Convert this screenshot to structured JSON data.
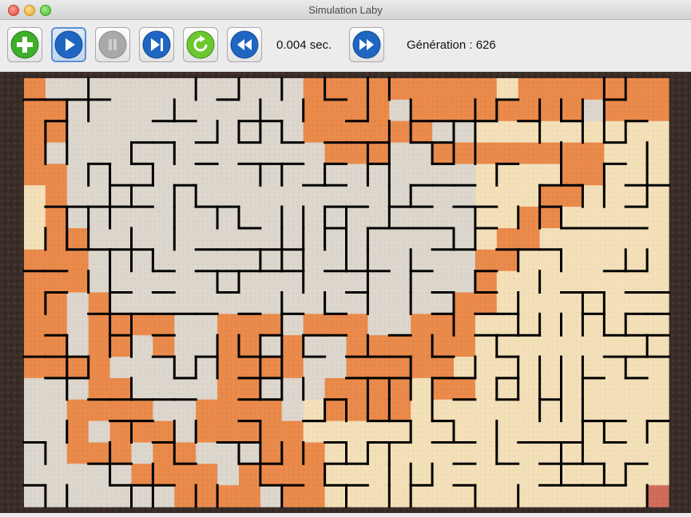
{
  "window": {
    "title": "Simulation Laby"
  },
  "toolbar": {
    "buttons": [
      {
        "name": "add-button",
        "icon": "plus-icon",
        "color": "#3fae2a"
      },
      {
        "name": "play-button",
        "icon": "play-icon",
        "color": "#1f66c2",
        "active": true
      },
      {
        "name": "pause-button",
        "icon": "pause-icon",
        "color": "#a9a9a9",
        "disabled": true
      },
      {
        "name": "step-forward-button",
        "icon": "step-forward-icon",
        "color": "#1f66c2"
      },
      {
        "name": "reset-button",
        "icon": "refresh-icon",
        "color": "#4db52e"
      },
      {
        "name": "slower-button",
        "icon": "rewind-icon",
        "color": "#1f66c2"
      },
      {
        "name": "faster-button",
        "icon": "fast-forward-icon",
        "color": "#1f66c2"
      }
    ],
    "delay_label": "0.004 sec.",
    "generation_label": "Génération : 626"
  },
  "maze": {
    "colors": {
      "visited": "#e9894a",
      "explored": "#dcd6cc",
      "unexplored": "#f3dfb8",
      "exit": "#d06b5a",
      "border": "#3a2d28",
      "wall": "#000000"
    }
  }
}
